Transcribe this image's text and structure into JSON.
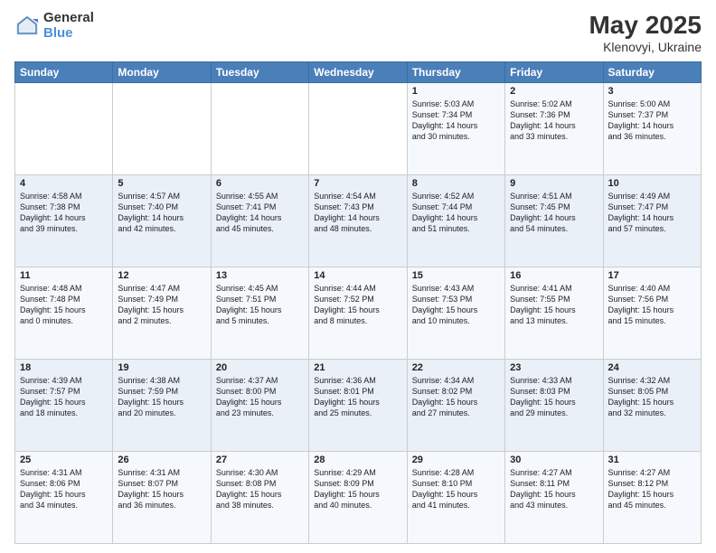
{
  "logo": {
    "general": "General",
    "blue": "Blue"
  },
  "header": {
    "title": "May 2025",
    "subtitle": "Klenovyi, Ukraine"
  },
  "weekdays": [
    "Sunday",
    "Monday",
    "Tuesday",
    "Wednesday",
    "Thursday",
    "Friday",
    "Saturday"
  ],
  "weeks": [
    [
      {
        "day": "",
        "info": ""
      },
      {
        "day": "",
        "info": ""
      },
      {
        "day": "",
        "info": ""
      },
      {
        "day": "",
        "info": ""
      },
      {
        "day": "1",
        "info": "Sunrise: 5:03 AM\nSunset: 7:34 PM\nDaylight: 14 hours\nand 30 minutes."
      },
      {
        "day": "2",
        "info": "Sunrise: 5:02 AM\nSunset: 7:36 PM\nDaylight: 14 hours\nand 33 minutes."
      },
      {
        "day": "3",
        "info": "Sunrise: 5:00 AM\nSunset: 7:37 PM\nDaylight: 14 hours\nand 36 minutes."
      }
    ],
    [
      {
        "day": "4",
        "info": "Sunrise: 4:58 AM\nSunset: 7:38 PM\nDaylight: 14 hours\nand 39 minutes."
      },
      {
        "day": "5",
        "info": "Sunrise: 4:57 AM\nSunset: 7:40 PM\nDaylight: 14 hours\nand 42 minutes."
      },
      {
        "day": "6",
        "info": "Sunrise: 4:55 AM\nSunset: 7:41 PM\nDaylight: 14 hours\nand 45 minutes."
      },
      {
        "day": "7",
        "info": "Sunrise: 4:54 AM\nSunset: 7:43 PM\nDaylight: 14 hours\nand 48 minutes."
      },
      {
        "day": "8",
        "info": "Sunrise: 4:52 AM\nSunset: 7:44 PM\nDaylight: 14 hours\nand 51 minutes."
      },
      {
        "day": "9",
        "info": "Sunrise: 4:51 AM\nSunset: 7:45 PM\nDaylight: 14 hours\nand 54 minutes."
      },
      {
        "day": "10",
        "info": "Sunrise: 4:49 AM\nSunset: 7:47 PM\nDaylight: 14 hours\nand 57 minutes."
      }
    ],
    [
      {
        "day": "11",
        "info": "Sunrise: 4:48 AM\nSunset: 7:48 PM\nDaylight: 15 hours\nand 0 minutes."
      },
      {
        "day": "12",
        "info": "Sunrise: 4:47 AM\nSunset: 7:49 PM\nDaylight: 15 hours\nand 2 minutes."
      },
      {
        "day": "13",
        "info": "Sunrise: 4:45 AM\nSunset: 7:51 PM\nDaylight: 15 hours\nand 5 minutes."
      },
      {
        "day": "14",
        "info": "Sunrise: 4:44 AM\nSunset: 7:52 PM\nDaylight: 15 hours\nand 8 minutes."
      },
      {
        "day": "15",
        "info": "Sunrise: 4:43 AM\nSunset: 7:53 PM\nDaylight: 15 hours\nand 10 minutes."
      },
      {
        "day": "16",
        "info": "Sunrise: 4:41 AM\nSunset: 7:55 PM\nDaylight: 15 hours\nand 13 minutes."
      },
      {
        "day": "17",
        "info": "Sunrise: 4:40 AM\nSunset: 7:56 PM\nDaylight: 15 hours\nand 15 minutes."
      }
    ],
    [
      {
        "day": "18",
        "info": "Sunrise: 4:39 AM\nSunset: 7:57 PM\nDaylight: 15 hours\nand 18 minutes."
      },
      {
        "day": "19",
        "info": "Sunrise: 4:38 AM\nSunset: 7:59 PM\nDaylight: 15 hours\nand 20 minutes."
      },
      {
        "day": "20",
        "info": "Sunrise: 4:37 AM\nSunset: 8:00 PM\nDaylight: 15 hours\nand 23 minutes."
      },
      {
        "day": "21",
        "info": "Sunrise: 4:36 AM\nSunset: 8:01 PM\nDaylight: 15 hours\nand 25 minutes."
      },
      {
        "day": "22",
        "info": "Sunrise: 4:34 AM\nSunset: 8:02 PM\nDaylight: 15 hours\nand 27 minutes."
      },
      {
        "day": "23",
        "info": "Sunrise: 4:33 AM\nSunset: 8:03 PM\nDaylight: 15 hours\nand 29 minutes."
      },
      {
        "day": "24",
        "info": "Sunrise: 4:32 AM\nSunset: 8:05 PM\nDaylight: 15 hours\nand 32 minutes."
      }
    ],
    [
      {
        "day": "25",
        "info": "Sunrise: 4:31 AM\nSunset: 8:06 PM\nDaylight: 15 hours\nand 34 minutes."
      },
      {
        "day": "26",
        "info": "Sunrise: 4:31 AM\nSunset: 8:07 PM\nDaylight: 15 hours\nand 36 minutes."
      },
      {
        "day": "27",
        "info": "Sunrise: 4:30 AM\nSunset: 8:08 PM\nDaylight: 15 hours\nand 38 minutes."
      },
      {
        "day": "28",
        "info": "Sunrise: 4:29 AM\nSunset: 8:09 PM\nDaylight: 15 hours\nand 40 minutes."
      },
      {
        "day": "29",
        "info": "Sunrise: 4:28 AM\nSunset: 8:10 PM\nDaylight: 15 hours\nand 41 minutes."
      },
      {
        "day": "30",
        "info": "Sunrise: 4:27 AM\nSunset: 8:11 PM\nDaylight: 15 hours\nand 43 minutes."
      },
      {
        "day": "31",
        "info": "Sunrise: 4:27 AM\nSunset: 8:12 PM\nDaylight: 15 hours\nand 45 minutes."
      }
    ]
  ]
}
